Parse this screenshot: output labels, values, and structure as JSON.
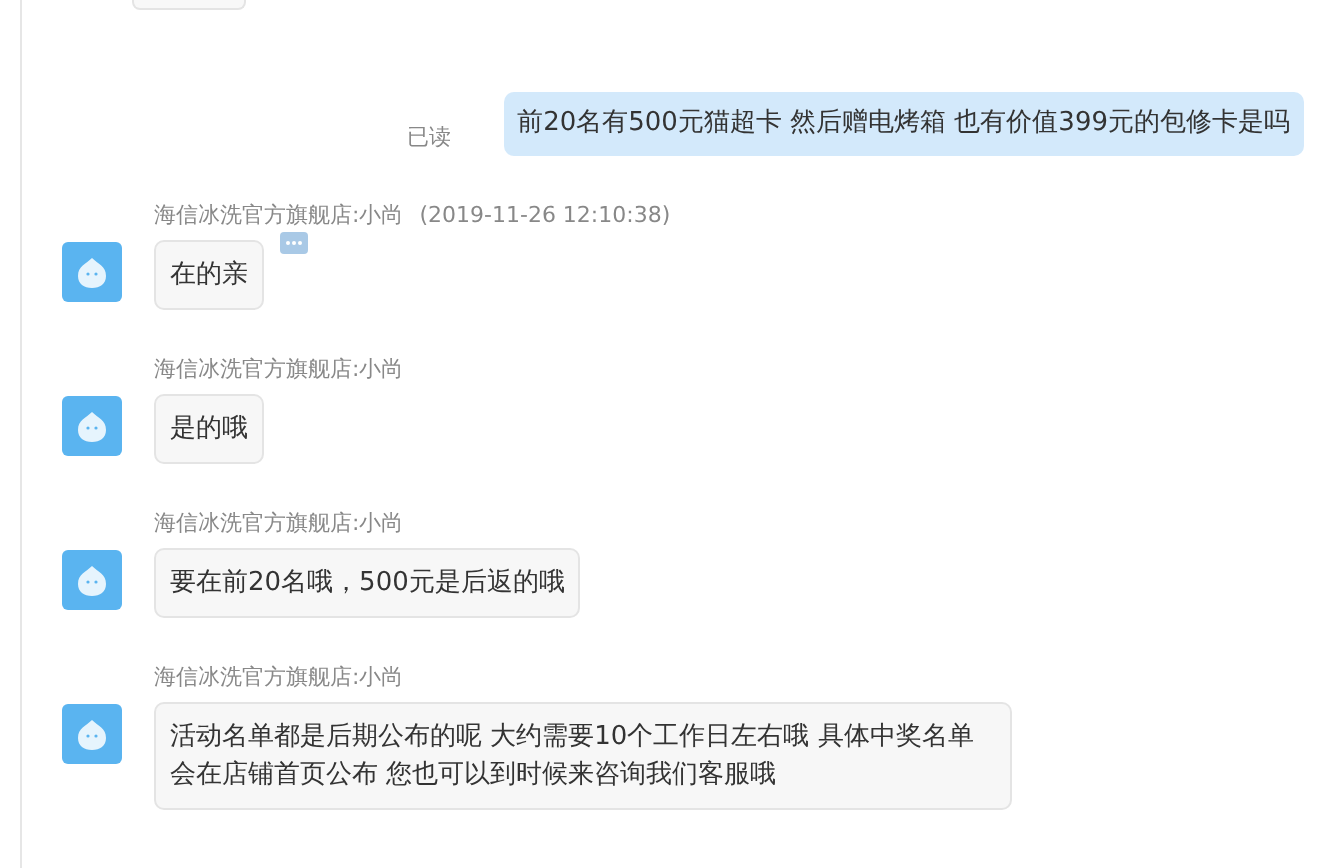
{
  "messages": [
    {
      "kind": "outgoing",
      "text": "前20名有500元猫超卡 然后赠电烤箱 也有价值399元的包修卡是吗",
      "status": "已读"
    },
    {
      "kind": "incoming",
      "sender": "海信冰洗官方旗舰店:小尚",
      "timestamp": "(2019-11-26 12:10:38)",
      "text": "在的亲",
      "has_menu": true
    },
    {
      "kind": "incoming",
      "sender": "海信冰洗官方旗舰店:小尚",
      "text": "是的哦",
      "has_menu": false
    },
    {
      "kind": "incoming",
      "sender": "海信冰洗官方旗舰店:小尚",
      "text": "要在前20名哦，500元是后返的哦",
      "has_menu": false
    },
    {
      "kind": "incoming",
      "sender": "海信冰洗官方旗舰店:小尚",
      "text": "活动名单都是后期公布的呢 大约需要10个工作日左右哦  具体中奖名单会在店铺首页公布 您也可以到时候来咨询我们客服哦",
      "has_menu": false
    }
  ]
}
